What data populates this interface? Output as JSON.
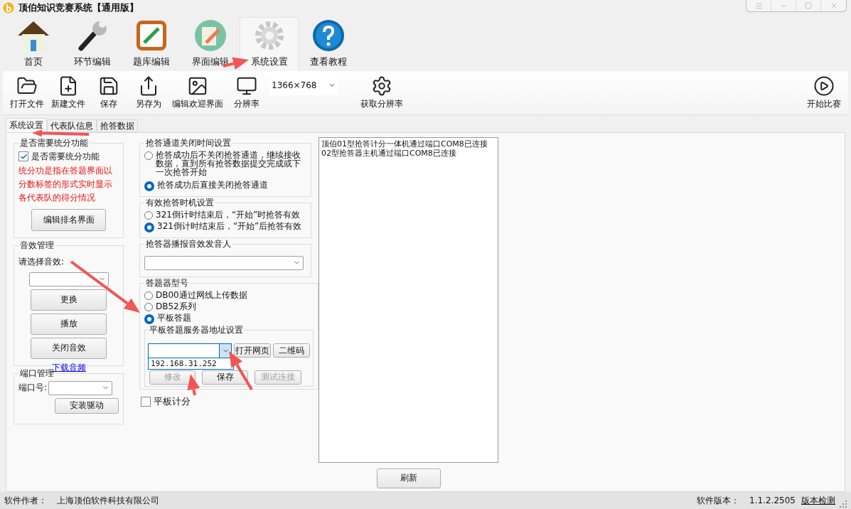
{
  "window": {
    "title": "顶伯知识竞赛系统【通用版】"
  },
  "ribbon_tabs": [
    {
      "kind": "home",
      "label": "首页",
      "selected": false
    },
    {
      "kind": "wrench",
      "label": "环节编辑",
      "selected": false
    },
    {
      "kind": "notebook",
      "label": "题库编辑",
      "selected": false
    },
    {
      "kind": "pencil",
      "label": "界面编辑",
      "selected": false
    },
    {
      "kind": "gear",
      "label": "系统设置",
      "selected": true
    },
    {
      "kind": "help",
      "label": "查看教程",
      "selected": false
    }
  ],
  "toolbar": {
    "items": [
      {
        "kind": "folder",
        "label": "打开文件"
      },
      {
        "kind": "newfile",
        "label": "新建文件"
      },
      {
        "kind": "save",
        "label": "保存"
      },
      {
        "kind": "export",
        "label": "另存为"
      },
      {
        "kind": "image",
        "label": "编辑欢迎界面"
      },
      {
        "kind": "monitor",
        "label": "分辨率"
      },
      {
        "kind": "select",
        "label": "1366×768"
      },
      {
        "kind": "gear",
        "label": "获取分辨率"
      }
    ],
    "end_button": "开始比赛"
  },
  "tabs": [
    {
      "label": "系统设置",
      "selected": true
    },
    {
      "label": "代表队信息",
      "selected": false
    },
    {
      "label": "抢答数据",
      "selected": false
    }
  ],
  "scoring_group": {
    "title": "是否需要统分功能",
    "checkbox": {
      "label": "是否需要统分功能",
      "checked": true
    },
    "note": "统分功是指在答题界面以分数标签的形式实时显示各代表队的得分情况",
    "button": "编辑排名界面"
  },
  "sound_group": {
    "title": "音效管理",
    "label": "请选择音效:",
    "buttons": [
      "更换",
      "播放",
      "关闭音效"
    ],
    "link": "下载音频"
  },
  "port_group": {
    "title": "端口管理",
    "label": "端口号:",
    "button": "安装驱动"
  },
  "channel_close_group": {
    "title": "抢答通道关闭时间设置",
    "options": [
      {
        "label": "抢答成功后不关闭抢答通道，继续接收数据，直到所有抢答数据提交完成或下一次抢答开始",
        "selected": false
      },
      {
        "label": "抢答成功后直接关闭抢答通道",
        "selected": true
      }
    ]
  },
  "timing_group": {
    "title": "有效抢答时机设置",
    "options": [
      {
        "label": "321倒计时结束后，“开始”时抢答有效",
        "selected": false
      },
      {
        "label": "321倒计时结束后，“开始”后抢答有效",
        "selected": true
      }
    ]
  },
  "voice_group": {
    "title": "抢答器播报音效发音人"
  },
  "device_group": {
    "title": "答题器型号",
    "options": [
      {
        "label": "DB00通过网线上传数据",
        "selected": false
      },
      {
        "label": "DB52系列",
        "selected": false
      },
      {
        "label": "平板答题",
        "selected": true
      }
    ],
    "server_group": {
      "title": "平板答题服务器地址设置",
      "dropdown_items": [
        "192.168.31.252"
      ],
      "buttons": [
        {
          "label": "打开网页",
          "disabled": false
        },
        {
          "label": "二维码",
          "disabled": false
        }
      ],
      "lower_buttons": [
        {
          "label": "修改",
          "disabled": true
        },
        {
          "label": "保存",
          "disabled": false
        },
        {
          "label": "测试连接",
          "disabled": true
        }
      ]
    }
  },
  "tablet_scoring": {
    "label": "平板计分",
    "checked": false
  },
  "log": {
    "lines": [
      "顶伯01型抢答计分一体机通过端口COM8已连接",
      "02型抢答器主机通过端口COM8已连接"
    ]
  },
  "refresh_button": "刷新",
  "status_bar": {
    "author_label": "软件作者：",
    "author": "上海顶伯软件科技有限公司",
    "version_label": "软件版本：",
    "version": "1.1.2.2505",
    "check_link": "版本检测"
  }
}
